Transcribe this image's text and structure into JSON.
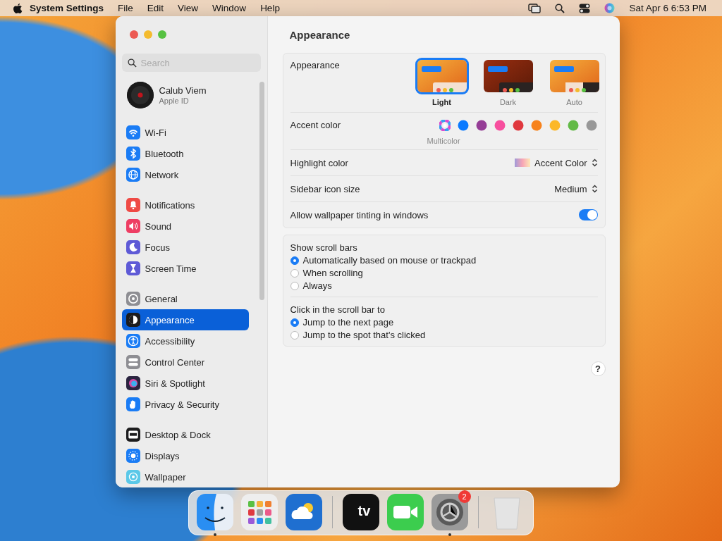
{
  "menubar": {
    "app": "System Settings",
    "menus": [
      "File",
      "Edit",
      "View",
      "Window",
      "Help"
    ],
    "clock": "Sat Apr 6  6:53 PM"
  },
  "window": {
    "title": "Appearance",
    "search": {
      "placeholder": "Search"
    },
    "account": {
      "name": "Calub Viem",
      "subtitle": "Apple ID"
    },
    "sidebar_groups": [
      [
        {
          "label": "Wi-Fi",
          "kind": "wifi",
          "color": "#1a7cf5",
          "selected": false
        },
        {
          "label": "Bluetooth",
          "kind": "bluetooth",
          "color": "#1a7cf5",
          "selected": false
        },
        {
          "label": "Network",
          "kind": "globe",
          "color": "#1a7cf5",
          "selected": false
        }
      ],
      [
        {
          "label": "Notifications",
          "kind": "bell",
          "color": "#ef4a45",
          "selected": false
        },
        {
          "label": "Sound",
          "kind": "speaker",
          "color": "#ee3d63",
          "selected": false
        },
        {
          "label": "Focus",
          "kind": "moon",
          "color": "#5e5ad6",
          "selected": false
        },
        {
          "label": "Screen Time",
          "kind": "hourglass",
          "color": "#5e5ad6",
          "selected": false
        }
      ],
      [
        {
          "label": "General",
          "kind": "gear",
          "color": "#8e8e93",
          "selected": false
        },
        {
          "label": "Appearance",
          "kind": "contrast",
          "color": "#1c1c1e",
          "selected": true
        },
        {
          "label": "Accessibility",
          "kind": "person",
          "color": "#1a7cf5",
          "selected": false
        },
        {
          "label": "Control Center",
          "kind": "switches",
          "color": "#8e8e93",
          "selected": false
        },
        {
          "label": "Siri & Spotlight",
          "kind": "orb",
          "color": "#2a2440",
          "selected": false
        },
        {
          "label": "Privacy & Security",
          "kind": "hand",
          "color": "#1a7cf5",
          "selected": false
        }
      ],
      [
        {
          "label": "Desktop & Dock",
          "kind": "display",
          "color": "#1c1c1e",
          "selected": false
        },
        {
          "label": "Displays",
          "kind": "sun",
          "color": "#1a7cf5",
          "selected": false
        },
        {
          "label": "Wallpaper",
          "kind": "flower",
          "color": "#5ac8e8",
          "selected": false
        }
      ]
    ],
    "appearance": {
      "label": "Appearance",
      "options": [
        {
          "label": "Light",
          "kind": "light",
          "selected": true
        },
        {
          "label": "Dark",
          "kind": "dark",
          "selected": false
        },
        {
          "label": "Auto",
          "kind": "auto",
          "selected": false
        }
      ]
    },
    "accent": {
      "label": "Accent color",
      "caption": "Multicolor",
      "colors": [
        {
          "kind": "multi",
          "color": "#d94fd0",
          "selected": true
        },
        {
          "kind": "solid",
          "color": "#0a7aff",
          "selected": false
        },
        {
          "kind": "solid",
          "color": "#953d96",
          "selected": false
        },
        {
          "kind": "solid",
          "color": "#f74f9e",
          "selected": false
        },
        {
          "kind": "solid",
          "color": "#e0383e",
          "selected": false
        },
        {
          "kind": "solid",
          "color": "#f7821b",
          "selected": false
        },
        {
          "kind": "solid",
          "color": "#fcb827",
          "selected": false
        },
        {
          "kind": "solid",
          "color": "#62ba46",
          "selected": false
        },
        {
          "kind": "solid",
          "color": "#989898",
          "selected": false
        }
      ]
    },
    "highlight": {
      "label": "Highlight color",
      "value": "Accent Color"
    },
    "icon_size": {
      "label": "Sidebar icon size",
      "value": "Medium"
    },
    "tinting": {
      "label": "Allow wallpaper tinting in windows",
      "on": true
    },
    "scroll_groups": [
      {
        "title": "Show scroll bars",
        "options": [
          {
            "label": "Automatically based on mouse or trackpad",
            "selected": true
          },
          {
            "label": "When scrolling",
            "selected": false
          },
          {
            "label": "Always",
            "selected": false
          }
        ]
      },
      {
        "title": "Click in the scroll bar to",
        "options": [
          {
            "label": "Jump to the next page",
            "selected": true
          },
          {
            "label": "Jump to the spot that's clicked",
            "selected": false
          }
        ]
      }
    ],
    "help": "?"
  },
  "dock": {
    "apps": [
      {
        "kind": "finder",
        "running": true
      },
      {
        "kind": "launchpad",
        "running": false
      },
      {
        "kind": "weather",
        "running": false
      },
      {
        "kind": "separator"
      },
      {
        "kind": "tv",
        "label": "tv",
        "running": false
      },
      {
        "kind": "facetime",
        "running": false
      },
      {
        "kind": "settings",
        "running": true,
        "badge": "2"
      },
      {
        "kind": "separator"
      },
      {
        "kind": "trash",
        "running": false
      }
    ]
  }
}
